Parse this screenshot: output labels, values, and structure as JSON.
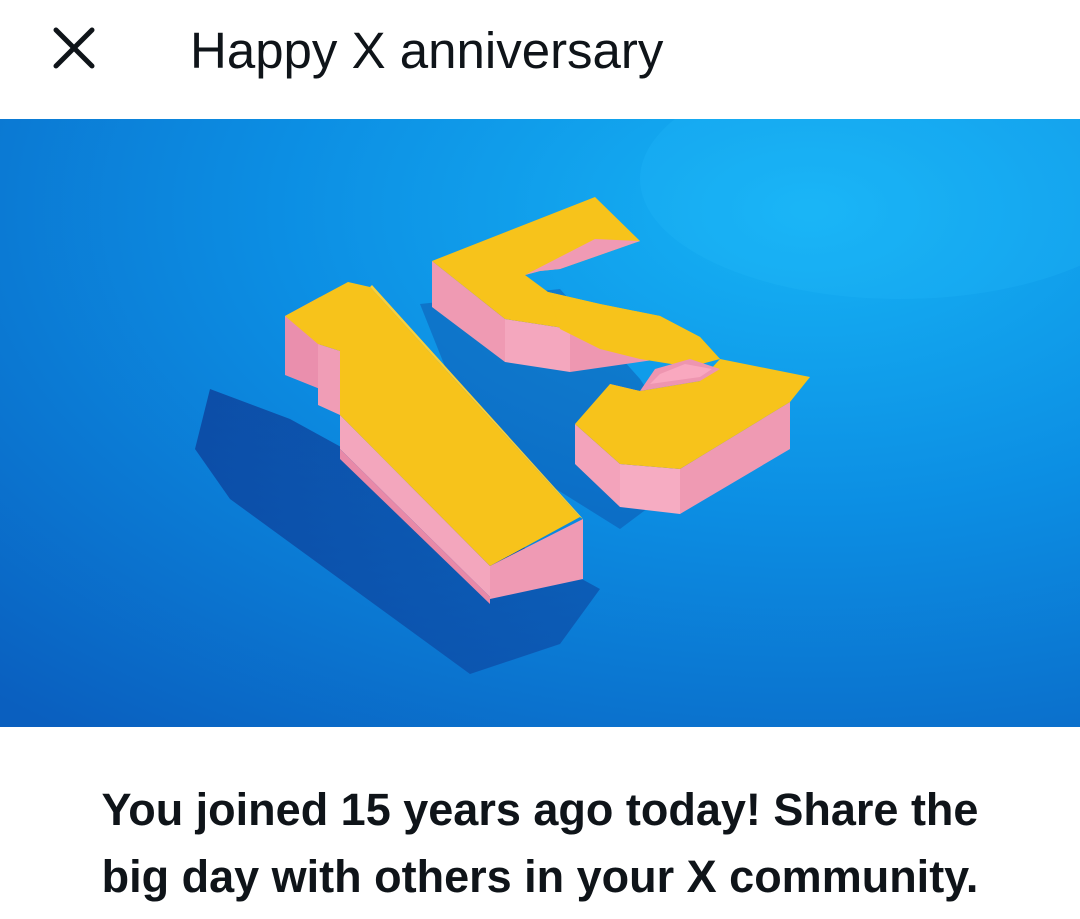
{
  "header": {
    "close_icon": "close-icon",
    "title": "Happy X anniversary"
  },
  "hero": {
    "image_subject": "15",
    "colors": {
      "background": "#0a7fd8",
      "digit_top": "#f7c21a",
      "digit_side": "#ee9ab4"
    }
  },
  "message": {
    "line1": "You joined 15 years ago today! Share the",
    "line2": "big day with others in your X community."
  }
}
